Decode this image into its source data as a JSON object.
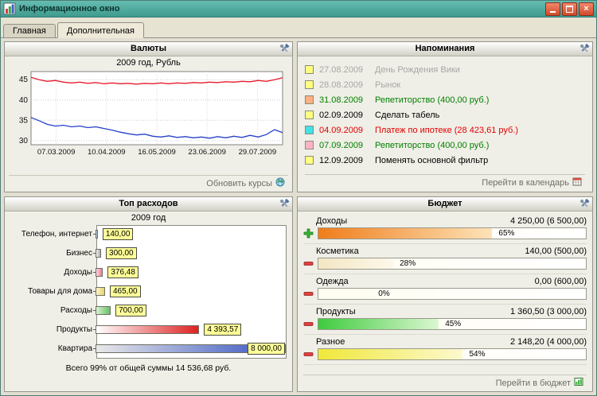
{
  "window": {
    "title": "Информационное окно"
  },
  "tabs": [
    {
      "label": "Главная"
    },
    {
      "label": "Дополнительная"
    }
  ],
  "panels": {
    "currencies": {
      "title": "Валюты",
      "update_link": "Обновить курсы"
    },
    "reminders": {
      "title": "Напоминания",
      "calendar_link": "Перейти в календарь",
      "items": [
        {
          "date": "27.08.2009",
          "text": "День Рождения Вики",
          "marker": "#ffff80",
          "date_color": "#a6a6a6",
          "text_color": "#a6a6a6"
        },
        {
          "date": "28.08.2009",
          "text": "Рынок",
          "marker": "#ffff80",
          "date_color": "#a6a6a6",
          "text_color": "#a6a6a6"
        },
        {
          "date": "31.08.2009",
          "text": "Репетиторство (400,00 руб.)",
          "marker": "#ffb080",
          "date_color": "#008000",
          "text_color": "#008000"
        },
        {
          "date": "02.09.2009",
          "text": "Сделать табель",
          "marker": "#ffff80",
          "date_color": "#000000",
          "text_color": "#000000"
        },
        {
          "date": "04.09.2009",
          "text": "Платеж по ипотеке (28 423,61 руб.)",
          "marker": "#45e0e4",
          "date_color": "#e00000",
          "text_color": "#e00000"
        },
        {
          "date": "07.09.2009",
          "text": "Репетиторство (400,00 руб.)",
          "marker": "#ffb4c6",
          "date_color": "#008000",
          "text_color": "#008000"
        },
        {
          "date": "12.09.2009",
          "text": "Поменять основной фильтр",
          "marker": "#ffff80",
          "date_color": "#000000",
          "text_color": "#000000"
        }
      ]
    },
    "top_expenses": {
      "title": "Топ расходов"
    },
    "budget": {
      "title": "Бюджет",
      "budget_link": "Перейти в бюджет",
      "items": [
        {
          "name": "Доходы",
          "amount": "4 250,00 (6 500,00)",
          "percent": 65,
          "percent_label": "65%",
          "sign": "plus",
          "fill_from": "#ef7d1a",
          "fill_to": "#fde3b8"
        },
        {
          "name": "Косметика",
          "amount": "140,00 (500,00)",
          "percent": 28,
          "percent_label": "28%",
          "sign": "minus",
          "fill_from": "#f3e6c2",
          "fill_to": "#fcf8ea"
        },
        {
          "name": "Одежда",
          "amount": "0,00 (600,00)",
          "percent": 0,
          "percent_label": "0%",
          "sign": "minus",
          "fill_from": "#ffffff",
          "fill_to": "#ffffff"
        },
        {
          "name": "Продукты",
          "amount": "1 360,50 (3 000,00)",
          "percent": 45,
          "percent_label": "45%",
          "sign": "minus",
          "fill_from": "#3ecb3e",
          "fill_to": "#dcf7d2"
        },
        {
          "name": "Разное",
          "amount": "2 148,20 (4 000,00)",
          "percent": 54,
          "percent_label": "54%",
          "sign": "minus",
          "fill_from": "#f0e83a",
          "fill_to": "#fcf9cf"
        }
      ]
    }
  },
  "chart_data": [
    {
      "type": "line",
      "title": "2009 год, Рубль",
      "ylim": [
        29,
        47
      ],
      "yticks": [
        30,
        35,
        40,
        45
      ],
      "xticks": [
        "07.03.2009",
        "10.04.2009",
        "16.05.2009",
        "23.06.2009",
        "29.07.2009"
      ],
      "grid": true,
      "legend": "none",
      "series": [
        {
          "color": "#e81c2e",
          "values": [
            45.6,
            45.0,
            44.6,
            44.8,
            44.4,
            44.2,
            44.4,
            44.1,
            44.3,
            44.0,
            44.2,
            44.0,
            44.1,
            43.9,
            44.1,
            44.0,
            44.2,
            44.0,
            44.2,
            44.1,
            44.3,
            44.2,
            44.4,
            44.3,
            44.5,
            44.4,
            44.6,
            44.5,
            44.8,
            44.6,
            45.0,
            45.5
          ]
        },
        {
          "color": "#2440c8",
          "values": [
            35.7,
            34.9,
            34.0,
            33.6,
            33.8,
            33.4,
            33.6,
            33.2,
            33.4,
            33.0,
            32.6,
            32.1,
            31.7,
            31.4,
            31.6,
            31.1,
            30.9,
            31.2,
            30.8,
            31.0,
            30.7,
            30.9,
            30.6,
            31.0,
            30.7,
            31.1,
            30.8,
            31.3,
            30.9,
            31.5,
            32.7,
            32.0
          ]
        }
      ]
    },
    {
      "type": "bar",
      "title": "2009 год",
      "max_value": 8000,
      "footer": "Всего 99% от общей суммы 14 536,68 руб.",
      "items": [
        {
          "label": "Телефон, интернет",
          "value": 140.0,
          "value_label": "140,00",
          "color_from": "#cfe0ee",
          "color_to": "#8fb0d0"
        },
        {
          "label": "Бизнес",
          "value": 300.0,
          "value_label": "300,00",
          "color_from": "#f2f2f2",
          "color_to": "#a8a8a8"
        },
        {
          "label": "Доходы",
          "value": 376.48,
          "value_label": "376,48",
          "color_from": "#ffd6de",
          "color_to": "#e87e96"
        },
        {
          "label": "Товары для дома",
          "value": 465.0,
          "value_label": "465,00",
          "color_from": "#fdf6c8",
          "color_to": "#e3d36e"
        },
        {
          "label": "Расходы",
          "value": 700.0,
          "value_label": "700,00",
          "color_from": "#d8f2cf",
          "color_to": "#66c266"
        },
        {
          "label": "Продукты",
          "value": 4393.57,
          "value_label": "4 393,57",
          "color_from": "#ffffff",
          "color_to": "#dd2222"
        },
        {
          "label": "Квартира",
          "value": 8000.0,
          "value_label": "8 000,00",
          "color_from": "#e9e9e9",
          "color_to": "#2f4ec0"
        }
      ]
    }
  ]
}
